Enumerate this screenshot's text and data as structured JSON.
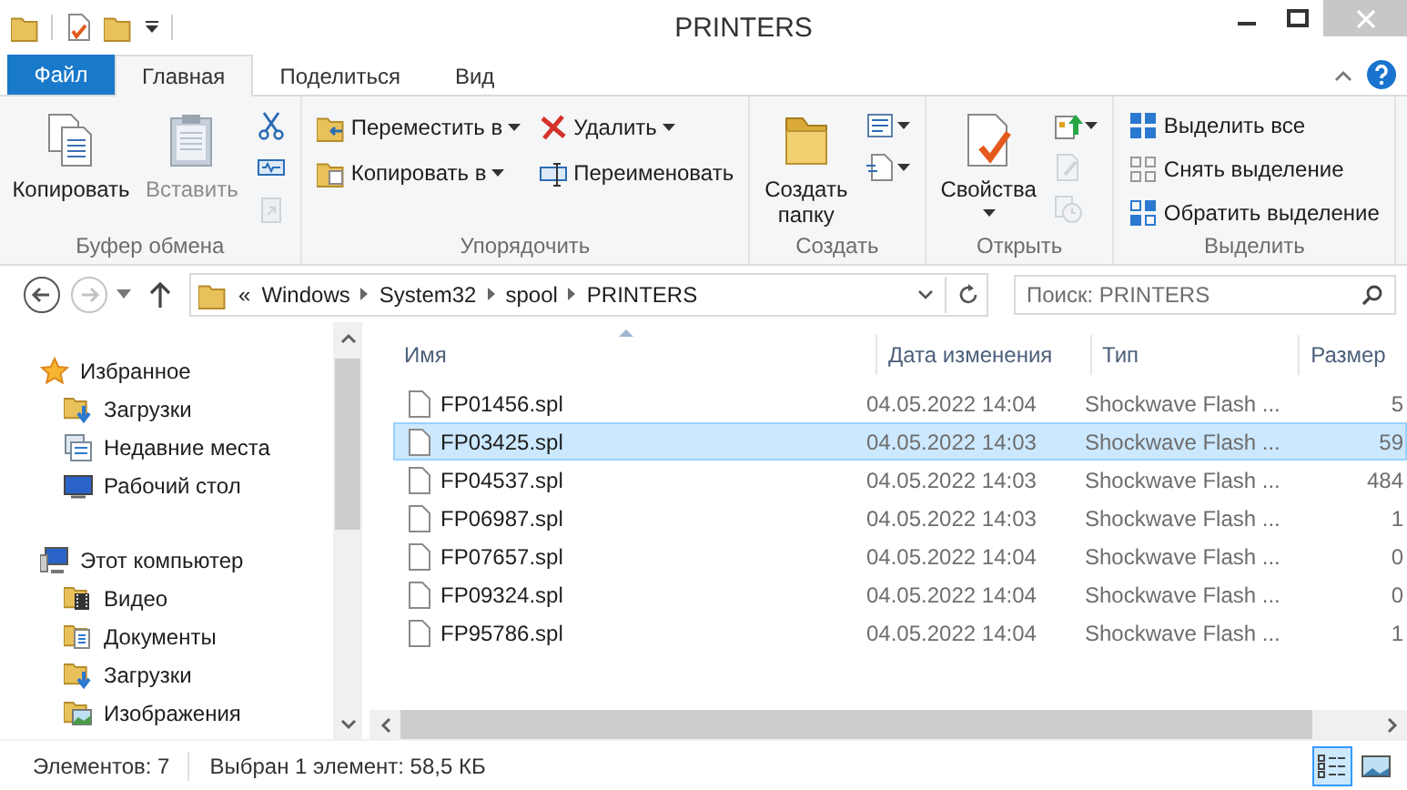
{
  "window": {
    "title": "PRINTERS"
  },
  "ribbon_tabs": [
    {
      "label": "Файл",
      "kind": "file",
      "selected": false
    },
    {
      "label": "Главная",
      "kind": "tab",
      "selected": true
    },
    {
      "label": "Поделиться",
      "kind": "tab",
      "selected": false
    },
    {
      "label": "Вид",
      "kind": "tab",
      "selected": false
    }
  ],
  "ribbon_groups": [
    {
      "label": "Буфер обмена",
      "columns": [
        [
          {
            "label": "Копировать",
            "kind": "large",
            "disabled": false,
            "dropdown": false
          }
        ],
        [
          {
            "label": "Вставить",
            "kind": "large",
            "disabled": true,
            "dropdown": false
          }
        ],
        [
          {
            "kind": "icon",
            "disabled": false,
            "dropdown": false
          },
          {
            "kind": "icon",
            "disabled": false,
            "dropdown": false
          },
          {
            "kind": "icon",
            "disabled": true,
            "dropdown": false
          }
        ]
      ]
    },
    {
      "label": "Упорядочить",
      "columns": [
        [
          {
            "label": "Переместить в",
            "kind": "small",
            "disabled": false,
            "dropdown": true
          },
          {
            "label": "Копировать в",
            "kind": "small",
            "disabled": false,
            "dropdown": true
          }
        ],
        [
          {
            "label": "Удалить",
            "kind": "small",
            "disabled": false,
            "dropdown": true
          },
          {
            "label": "Переименовать",
            "kind": "small",
            "disabled": false,
            "dropdown": false
          }
        ]
      ]
    },
    {
      "label": "Создать",
      "columns": [
        [
          {
            "lines": [
              "Создать",
              "папку"
            ],
            "kind": "large",
            "disabled": false,
            "dropdown": false
          }
        ],
        [
          {
            "kind": "icon",
            "disabled": false,
            "dropdown": true
          },
          {
            "kind": "icon",
            "disabled": false,
            "dropdown": true
          }
        ]
      ]
    },
    {
      "label": "Открыть",
      "columns": [
        [
          {
            "label": "Свойства",
            "kind": "large",
            "disabled": false,
            "dropdown": true
          }
        ],
        [
          {
            "kind": "icon",
            "disabled": false,
            "dropdown": true
          },
          {
            "kind": "icon",
            "disabled": true,
            "dropdown": false
          },
          {
            "kind": "icon",
            "disabled": true,
            "dropdown": false
          }
        ]
      ]
    },
    {
      "label": "Выделить",
      "columns": [
        [
          {
            "label": "Выделить все",
            "kind": "small",
            "disabled": false,
            "dropdown": false
          },
          {
            "label": "Снять выделение",
            "kind": "small",
            "disabled": false,
            "dropdown": false
          },
          {
            "label": "Обратить выделение",
            "kind": "small",
            "disabled": false,
            "dropdown": false
          }
        ]
      ]
    }
  ],
  "navigation": {
    "back_disabled": false,
    "forward_disabled": true
  },
  "address": {
    "overflow": "«",
    "segments": [
      "Windows",
      "System32",
      "spool",
      "PRINTERS"
    ]
  },
  "search": {
    "placeholder": "Поиск: PRINTERS"
  },
  "sidebar": {
    "items": [
      {
        "label": "Избранное",
        "children": [
          {
            "label": "Загрузки"
          },
          {
            "label": "Недавние места"
          },
          {
            "label": "Рабочий стол"
          }
        ]
      },
      {
        "label": "Этот компьютер",
        "children": [
          {
            "label": "Видео"
          },
          {
            "label": "Документы"
          },
          {
            "label": "Загрузки"
          },
          {
            "label": "Изображения"
          }
        ]
      }
    ]
  },
  "table": {
    "columns": [
      {
        "label": "Имя",
        "sorted": true
      },
      {
        "label": "Дата изменения",
        "sorted": false
      },
      {
        "label": "Тип",
        "sorted": false
      },
      {
        "label": "Размер",
        "sorted": false
      }
    ],
    "rows": [
      {
        "name": "FP01456.spl",
        "date": "04.05.2022 14:04",
        "type": "Shockwave Flash ...",
        "size": "5",
        "selected": false
      },
      {
        "name": "FP03425.spl",
        "date": "04.05.2022 14:03",
        "type": "Shockwave Flash ...",
        "size": "59",
        "selected": true
      },
      {
        "name": "FP04537.spl",
        "date": "04.05.2022 14:03",
        "type": "Shockwave Flash ...",
        "size": "484",
        "selected": false
      },
      {
        "name": "FP06987.spl",
        "date": "04.05.2022 14:03",
        "type": "Shockwave Flash ...",
        "size": "1",
        "selected": false
      },
      {
        "name": "FP07657.spl",
        "date": "04.05.2022 14:04",
        "type": "Shockwave Flash ...",
        "size": "0",
        "selected": false
      },
      {
        "name": "FP09324.spl",
        "date": "04.05.2022 14:04",
        "type": "Shockwave Flash ...",
        "size": "0",
        "selected": false
      },
      {
        "name": "FP95786.spl",
        "date": "04.05.2022 14:04",
        "type": "Shockwave Flash ...",
        "size": "1",
        "selected": false
      }
    ]
  },
  "status_bar": {
    "items": [
      "Элементов: 7",
      "Выбран 1 элемент: 58,5 КБ"
    ],
    "views": [
      {
        "kind": "details",
        "selected": true
      },
      {
        "kind": "large_icons",
        "selected": false
      }
    ]
  }
}
